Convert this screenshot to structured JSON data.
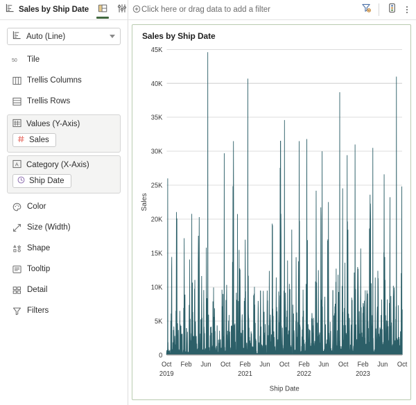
{
  "window": {
    "viz_title": "Sales by Ship Date"
  },
  "toolbar": {
    "tabs": [
      {
        "name": "layout-tab",
        "icon": "panel-layout-icon",
        "active": true
      },
      {
        "name": "settings-tab",
        "icon": "sliders-icon",
        "active": false
      }
    ],
    "filter_prompt": "Click here or drag data to add a filter",
    "filter_prompt_icon": "plus-circle-icon",
    "clear_filter_icon": "filter-clear-icon",
    "marks_settings_icon": "marks-settings-icon",
    "more_menu_icon": "kebab-menu-icon"
  },
  "sidebar": {
    "mark_type": {
      "label": "Auto (Line)",
      "icon": "line-chart-icon"
    },
    "rows": [
      {
        "label": "Tile",
        "icon": "tile-50-icon"
      },
      {
        "label": "Trellis Columns",
        "icon": "trellis-columns-icon"
      },
      {
        "label": "Trellis Rows",
        "icon": "trellis-rows-icon"
      }
    ],
    "shelves": [
      {
        "label": "Values (Y-Axis)",
        "icon": "values-grid-icon",
        "pill": {
          "label": "Sales",
          "icon": "hash-icon",
          "icon_color": "#e8736a"
        }
      },
      {
        "label": "Category (X-Axis)",
        "icon": "category-a-icon",
        "pill": {
          "label": "Ship Date",
          "icon": "clock-icon",
          "icon_color": "#8e6fb0"
        }
      }
    ],
    "rows2": [
      {
        "label": "Color",
        "icon": "palette-icon"
      },
      {
        "label": "Size (Width)",
        "icon": "resize-arrow-icon"
      },
      {
        "label": "Shape",
        "icon": "shape-icon"
      },
      {
        "label": "Tooltip",
        "icon": "tooltip-icon"
      },
      {
        "label": "Detail",
        "icon": "detail-grid-icon"
      },
      {
        "label": "Filters",
        "icon": "funnel-icon"
      }
    ]
  },
  "chart_data": {
    "type": "line",
    "title": "Sales by Ship Date",
    "xlabel": "Ship Date",
    "ylabel": "Sales",
    "line_color": "#2c5f68",
    "grid": true,
    "legend": "none",
    "ylim": [
      0,
      45000
    ],
    "yticks": [
      0,
      5000,
      10000,
      15000,
      20000,
      25000,
      30000,
      35000,
      40000,
      45000
    ],
    "ytick_labels": [
      "0",
      "5K",
      "10K",
      "15K",
      "20K",
      "25K",
      "30K",
      "35K",
      "40K",
      "45K"
    ],
    "xtick_labels": [
      {
        "top": "Oct",
        "bottom": "2019"
      },
      {
        "top": "Feb",
        "bottom": ""
      },
      {
        "top": "Jun",
        "bottom": ""
      },
      {
        "top": "Oct",
        "bottom": ""
      },
      {
        "top": "Feb",
        "bottom": "2021"
      },
      {
        "top": "Jun",
        "bottom": ""
      },
      {
        "top": "Oct",
        "bottom": ""
      },
      {
        "top": "Feb",
        "bottom": "2022"
      },
      {
        "top": "Jun",
        "bottom": ""
      },
      {
        "top": "Oct",
        "bottom": ""
      },
      {
        "top": "Feb",
        "bottom": "2023"
      },
      {
        "top": "Jun",
        "bottom": ""
      },
      {
        "top": "Oct",
        "bottom": ""
      }
    ],
    "x_range": [
      "2019-10",
      "2023-10"
    ],
    "series_name": "Sales",
    "notable_peaks": [
      {
        "x": "2020-06",
        "y": 44600
      },
      {
        "x": "2021-10",
        "y": 40700
      },
      {
        "x": "2023-09",
        "y": 41000
      },
      {
        "x": "2023-02",
        "y": 38700
      },
      {
        "x": "2022-02",
        "y": 34600
      },
      {
        "x": "2022-09",
        "y": 31800
      },
      {
        "x": "2021-05",
        "y": 29700
      },
      {
        "x": "2019-10",
        "y": 26000
      }
    ],
    "values": [
      1200,
      4100,
      800,
      15600,
      2300,
      9800,
      3400,
      26000,
      5200,
      1400,
      11300,
      7600,
      3100,
      18900,
      2400,
      8700,
      1100,
      16200,
      4500,
      21200,
      2800,
      12400,
      6300,
      1900,
      24800,
      3600,
      14100,
      800,
      9400,
      2200,
      17600,
      5800,
      1300,
      10900,
      3300,
      22400,
      7100,
      1600,
      13200,
      4700,
      8300,
      2000,
      19700,
      6400,
      1100,
      15800,
      3900,
      11600,
      2600,
      9100,
      44600,
      5400,
      1800,
      23100,
      7800,
      14900,
      3200,
      10200,
      2100,
      18400,
      6900,
      1500,
      12700,
      4300,
      8800,
      2500,
      20600,
      5100,
      1200,
      16900,
      3700,
      13400,
      2900,
      9600,
      7200,
      1700,
      21800,
      4900,
      11100,
      3000,
      17300,
      6100,
      1400,
      14500,
      2700,
      10600,
      40700,
      5600,
      1900,
      19200,
      8100,
      12900,
      3500,
      9300,
      2300,
      16100,
      6700,
      1300,
      13800,
      4200,
      34600,
      8500,
      2600,
      20100,
      5900,
      1600,
      15400,
      3800,
      11800,
      2400,
      10400,
      7400,
      1800,
      22900,
      5300,
      12200,
      3100,
      18700,
      6600,
      1500,
      14700,
      2800,
      31800,
      9900,
      4600,
      1200,
      17800,
      5700,
      13100,
      2900,
      10800,
      7900,
      1700,
      21400,
      4400,
      11900,
      3300,
      38700,
      6200,
      1400,
      15100,
      2500,
      9700,
      8200,
      2000,
      24300,
      5500,
      12600,
      3600,
      19500,
      7300,
      1600,
      16400,
      3000,
      41000,
      10100,
      4800,
      1300,
      20900,
      6800,
      14200,
      2700,
      11400,
      8600,
      1900,
      23600,
      5000,
      13700,
      3400,
      18100,
      7700,
      1500,
      15900,
      2200,
      9000,
      4000,
      12000,
      2600,
      20400,
      6000
    ]
  }
}
